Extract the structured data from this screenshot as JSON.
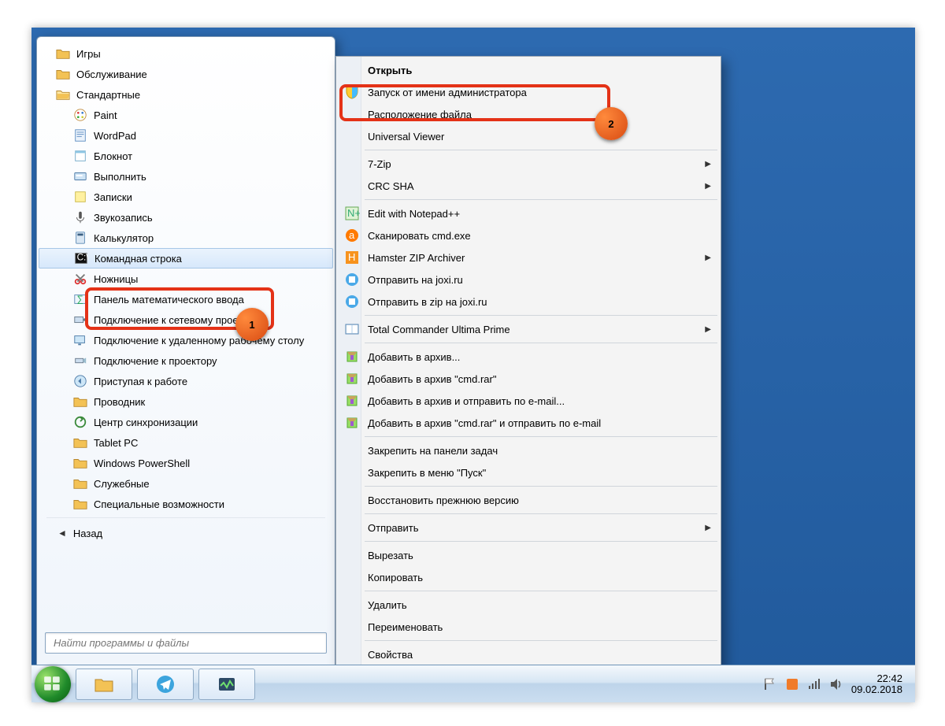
{
  "start_menu": {
    "folders_top": [
      {
        "label": "Игры",
        "type": "folder"
      },
      {
        "label": "Обслуживание",
        "type": "folder"
      },
      {
        "label": "Стандартные",
        "type": "folder-open"
      }
    ],
    "accessories": [
      {
        "label": "Paint",
        "icon": "paint"
      },
      {
        "label": "WordPad",
        "icon": "wordpad"
      },
      {
        "label": "Блокнот",
        "icon": "notepad"
      },
      {
        "label": "Выполнить",
        "icon": "run"
      },
      {
        "label": "Записки",
        "icon": "sticky"
      },
      {
        "label": "Звукозапись",
        "icon": "mic"
      },
      {
        "label": "Калькулятор",
        "icon": "calc"
      },
      {
        "label": "Командная строка",
        "icon": "cmd",
        "selected": true
      },
      {
        "label": "Ножницы",
        "icon": "snip"
      },
      {
        "label": "Панель математического ввода",
        "icon": "math"
      },
      {
        "label": "Подключение к сетевому проектору",
        "icon": "netproj"
      },
      {
        "label": "Подключение к удаленному рабочему столу",
        "icon": "rdp"
      },
      {
        "label": "Подключение к проектору",
        "icon": "proj"
      },
      {
        "label": "Приступая к работе",
        "icon": "getting"
      },
      {
        "label": "Проводник",
        "icon": "explorer"
      },
      {
        "label": "Центр синхронизации",
        "icon": "sync"
      }
    ],
    "subfolders": [
      {
        "label": "Tablet PC"
      },
      {
        "label": "Windows PowerShell"
      },
      {
        "label": "Служебные"
      },
      {
        "label": "Специальные возможности"
      }
    ],
    "back_label": "Назад",
    "search_placeholder": "Найти программы и файлы"
  },
  "context_menu": {
    "items": [
      {
        "label": "Открыть",
        "bold": true
      },
      {
        "label": "Запуск от имени администратора",
        "icon": "shield"
      },
      {
        "label": "Расположение файла"
      },
      {
        "label": "Universal Viewer"
      },
      {
        "sep": true
      },
      {
        "label": "7-Zip",
        "submenu": true
      },
      {
        "label": "CRC SHA",
        "submenu": true
      },
      {
        "sep": true
      },
      {
        "label": "Edit with Notepad++",
        "icon": "npp"
      },
      {
        "label": "Сканировать cmd.exe",
        "icon": "avast"
      },
      {
        "label": "Hamster ZIP Archiver",
        "icon": "hamster",
        "submenu": true
      },
      {
        "label": "Отправить на joxi.ru",
        "icon": "joxi"
      },
      {
        "label": "Отправить в zip на joxi.ru",
        "icon": "joxi"
      },
      {
        "sep": true
      },
      {
        "label": "Total Commander Ultima Prime",
        "icon": "tc",
        "submenu": true
      },
      {
        "sep": true
      },
      {
        "label": "Добавить в архив...",
        "icon": "winrar"
      },
      {
        "label": "Добавить в архив \"cmd.rar\"",
        "icon": "winrar"
      },
      {
        "label": "Добавить в архив и отправить по e-mail...",
        "icon": "winrar"
      },
      {
        "label": "Добавить в архив \"cmd.rar\" и отправить по e-mail",
        "icon": "winrar"
      },
      {
        "sep": true
      },
      {
        "label": "Закрепить на панели задач"
      },
      {
        "label": "Закрепить в меню \"Пуск\""
      },
      {
        "sep": true
      },
      {
        "label": "Восстановить прежнюю версию"
      },
      {
        "sep": true
      },
      {
        "label": "Отправить",
        "submenu": true
      },
      {
        "sep": true
      },
      {
        "label": "Вырезать"
      },
      {
        "label": "Копировать"
      },
      {
        "sep": true
      },
      {
        "label": "Удалить"
      },
      {
        "label": "Переименовать"
      },
      {
        "sep": true
      },
      {
        "label": "Свойства"
      }
    ]
  },
  "taskbar": {
    "time": "22:42",
    "date": "09.02.2018"
  },
  "step_badges": {
    "one": "1",
    "two": "2"
  },
  "icons": {
    "folder": "folder-icon",
    "cmd": "cmd-icon",
    "shield": "shield-icon"
  }
}
